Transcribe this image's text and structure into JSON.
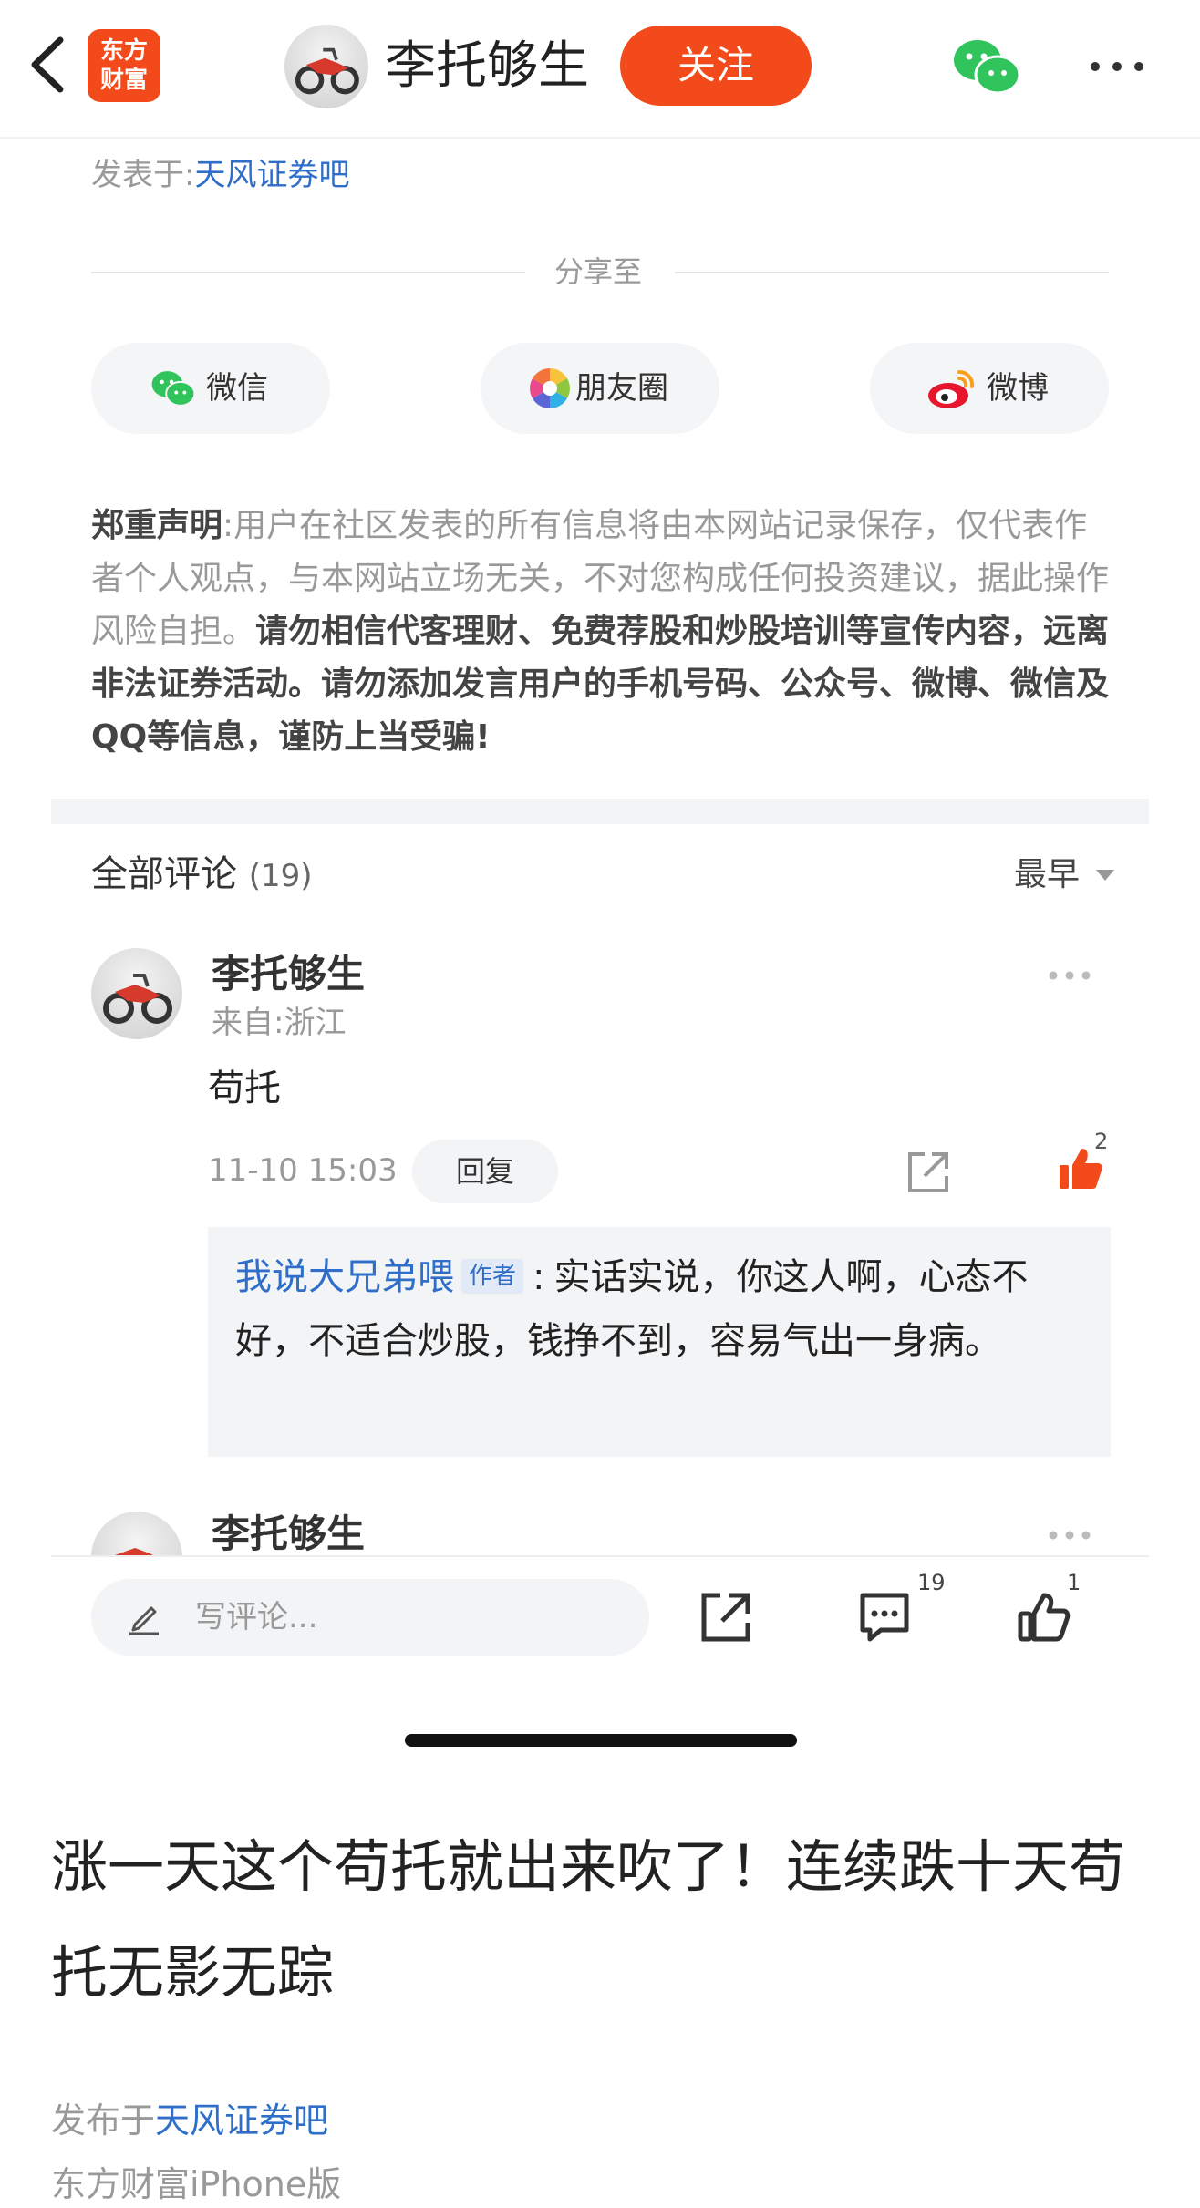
{
  "header": {
    "app_logo": "东方\n财富",
    "username": "李托够生",
    "follow_label": "关注",
    "icons": [
      "back-icon",
      "wechat-icon",
      "more-icon"
    ]
  },
  "post_meta": {
    "published_prefix": "发表于:",
    "forum": "天风证券吧"
  },
  "share": {
    "title": "分享至",
    "options": [
      {
        "label": "微信",
        "icon": "wechat-icon"
      },
      {
        "label": "朋友圈",
        "icon": "moments-icon"
      },
      {
        "label": "微博",
        "icon": "weibo-icon"
      }
    ]
  },
  "disclaimer": {
    "heading": "郑重声明",
    "colon": ":",
    "normal_text": "用户在社区发表的所有信息将由本网站记录保存，仅代表作者个人观点，与本网站立场无关，不对您构成任何投资建议，据此操作风险自担。",
    "bold_text": "请勿相信代客理财、免费荐股和炒股培训等宣传内容，远离非法证券活动。请勿添加发言用户的手机号码、公众号、微博、微信及QQ等信息，谨防上当受骗!"
  },
  "comments_section": {
    "title": "全部评论",
    "count": "(19)",
    "sort_label": "最早",
    "comments": [
      {
        "author": "李托够生",
        "location": "来自:浙江",
        "body": "苟托",
        "time": "11-10 15:03",
        "reply_label": "回复",
        "like_count": "2",
        "reply": {
          "author": "我说大兄弟喂",
          "tag": "作者",
          "separator": ":",
          "text": "实话实说，你这人啊，心态不好，不适合炒股，钱挣不到，容易气出一身病。"
        }
      },
      {
        "author": "李托够生"
      }
    ]
  },
  "bottom_bar": {
    "comment_placeholder": "写评论...",
    "comment_count": "19",
    "like_count": "1"
  },
  "article": {
    "title": "涨一天这个苟托就出来吹了！连续跌十天苟托无影无踪",
    "published_prefix": "发布于",
    "forum": "天风证券吧",
    "client": "东方财富iPhone版"
  },
  "colors": {
    "brand": "#f24a1a",
    "link": "#2f6ec9",
    "like": "#f24a1a"
  }
}
